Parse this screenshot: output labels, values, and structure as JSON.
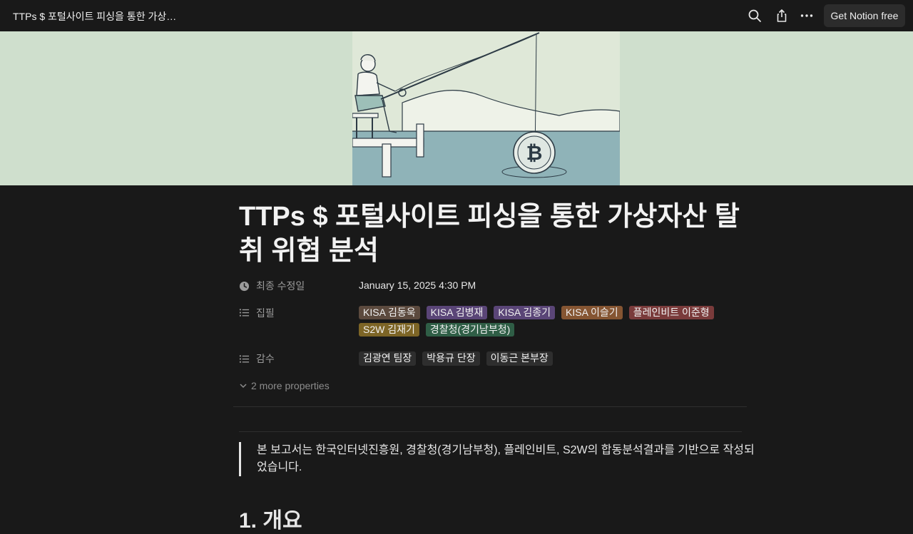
{
  "topbar": {
    "title": "TTPs $ 포털사이트 피싱을 통한 가상…",
    "search_icon": "search-icon",
    "share_icon": "share-icon",
    "more_icon": "more-icon",
    "cta_label": "Get Notion free"
  },
  "page": {
    "title": "TTPs $ 포털사이트 피싱을 통한 가상자산 탈취 위협 분석"
  },
  "properties": {
    "modified": {
      "label": "최종 수정일",
      "value": "January 15, 2025 4:30 PM",
      "icon": "clock-icon"
    },
    "writers": {
      "label": "집필",
      "icon": "list-icon",
      "tags": [
        {
          "text": "KISA 김동욱",
          "color": "#5c4a3e"
        },
        {
          "text": "KISA 김병재",
          "color": "#5a4577"
        },
        {
          "text": "KISA 김종기",
          "color": "#5a4577"
        },
        {
          "text": "KISA 이슬기",
          "color": "#855532"
        },
        {
          "text": "플레인비트 이준형",
          "color": "#7a3b3b"
        },
        {
          "text": "S2W 김재기",
          "color": "#7d6526"
        },
        {
          "text": "경찰청(경기남부청)",
          "color": "#2f5e46"
        }
      ]
    },
    "reviewers": {
      "label": "감수",
      "icon": "list-icon",
      "tags": [
        {
          "text": "김광연 팀장",
          "color": "#2e2e2e"
        },
        {
          "text": "박용규 단장",
          "color": "#2e2e2e"
        },
        {
          "text": "이동근 본부장",
          "color": "#2e2e2e"
        }
      ]
    },
    "more_label": "2 more properties"
  },
  "content": {
    "quote": "본 보고서는 한국인터넷진흥원, 경찰청(경기남부청), 플레인비트, S2W의 합동분석결과를 기반으로 작성되었습니다.",
    "heading": "1. 개요"
  }
}
